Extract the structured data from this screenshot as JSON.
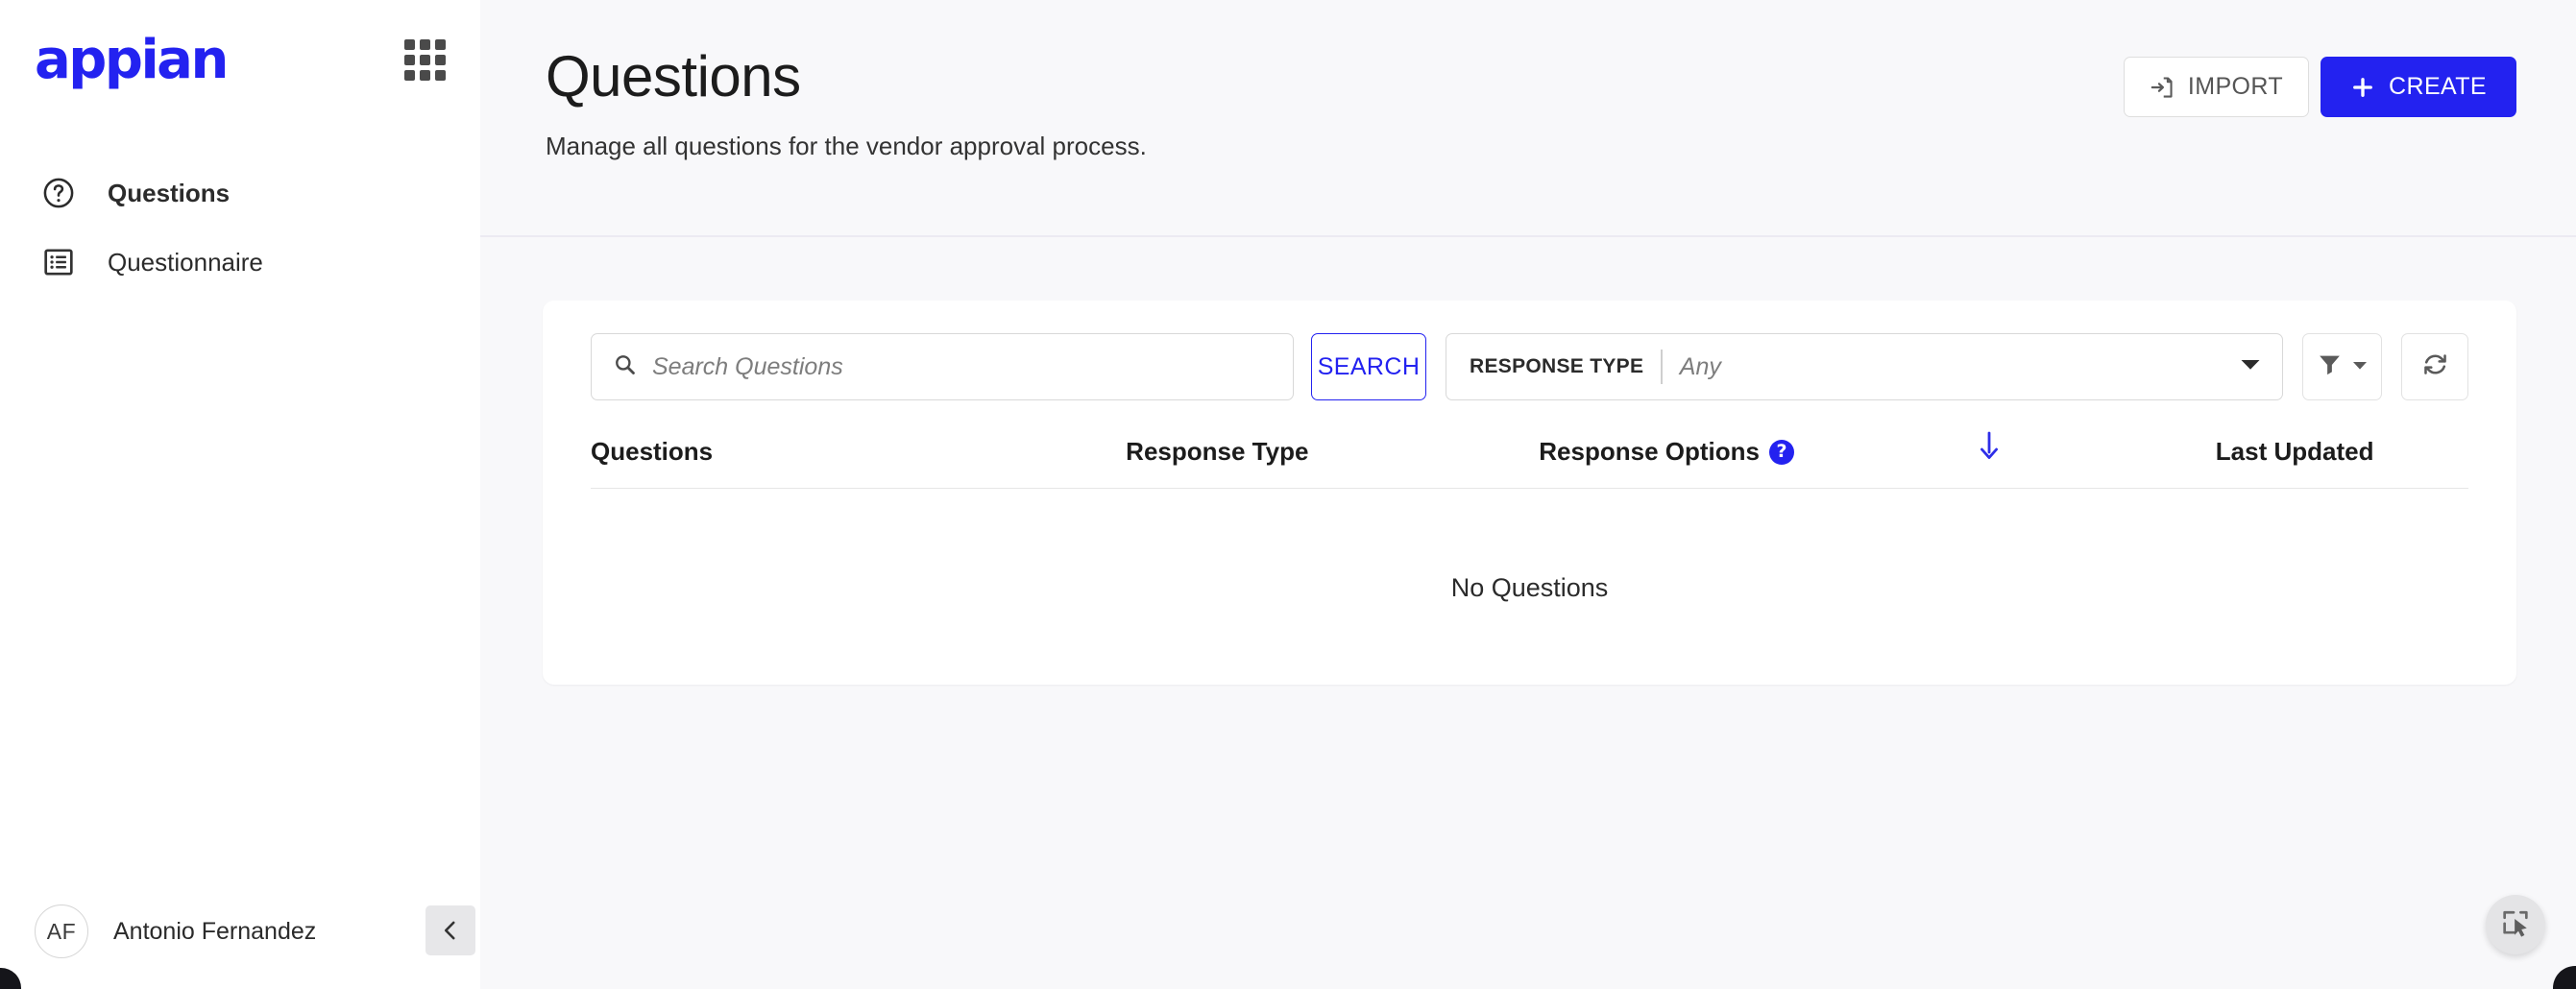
{
  "brand": {
    "logo_text": "appian",
    "logo_color": "#2322f0",
    "apps_icon": "grid-apps-icon"
  },
  "sidebar": {
    "items": [
      {
        "label": "Questions",
        "icon": "question-circle-icon",
        "active": true
      },
      {
        "label": "Questionnaire",
        "icon": "list-form-icon",
        "active": false
      }
    ],
    "user": {
      "initials": "AF",
      "name": "Antonio Fernandez",
      "collapse_icon": "chevron-left-icon"
    }
  },
  "header": {
    "title": "Questions",
    "subtitle": "Manage all questions for the vendor approval process.",
    "actions": {
      "import_label": "IMPORT",
      "import_icon": "file-import-icon",
      "create_label": "CREATE",
      "create_icon": "plus-icon",
      "primary_color": "#2322f0"
    }
  },
  "toolbar": {
    "search_placeholder": "Search Questions",
    "search_value": "",
    "search_icon": "search-icon",
    "search_button_label": "SEARCH",
    "response_type_label": "RESPONSE TYPE",
    "response_type_value": "Any",
    "response_type_options": [
      "Any"
    ],
    "filter_icon": "funnel-filter-icon",
    "filter_caret_icon": "caret-down-icon",
    "refresh_icon": "refresh-icon"
  },
  "table": {
    "columns": [
      {
        "label": "Questions",
        "help": false,
        "sort": false
      },
      {
        "label": "Response Type",
        "help": false,
        "sort": false
      },
      {
        "label": "Response Options",
        "help": true,
        "help_glyph": "?",
        "sort": false
      },
      {
        "label": "",
        "help": false,
        "sort": true,
        "sort_icon": "arrow-down-icon",
        "sort_color": "#2e2ee8"
      },
      {
        "label": "Last Updated",
        "help": false,
        "sort": false
      }
    ],
    "rows": [],
    "empty_message": "No Questions"
  },
  "fab": {
    "icon": "select-region-cursor-icon"
  }
}
